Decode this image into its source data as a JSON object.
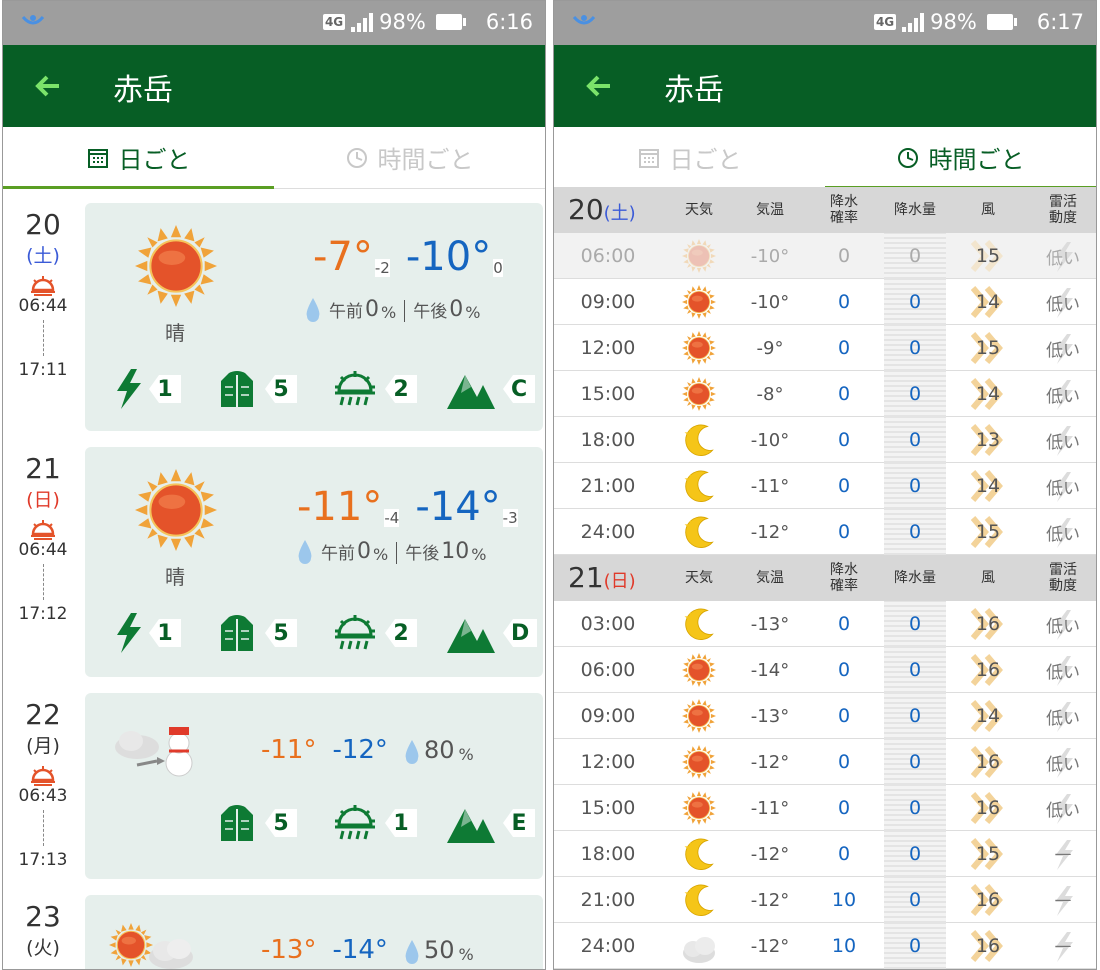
{
  "colors": {
    "appbar": "#075e25",
    "accent": "#5a9e23",
    "temp_high": "#e8701e",
    "temp_low": "#1565c0",
    "sat": "#3b5bd7",
    "sun": "#e03a2a"
  },
  "left": {
    "status": {
      "net": "4G",
      "battery": "98%",
      "time": "6:16"
    },
    "title": "赤岳",
    "tabs": [
      "日ごと",
      "時間ごと"
    ],
    "active_tab": 0,
    "days": [
      {
        "date": "20",
        "weekday": "(土)",
        "wk_color": "sat",
        "sunrise": "06:44",
        "sunset": "17:11",
        "icon": "sun-icon",
        "weather": "晴",
        "tmax": "-7°",
        "tmax_diff": "-2",
        "tmin": "-10°",
        "tmin_diff": "0",
        "am_label": "午前",
        "am": "0",
        "pm_label": "午後",
        "pm": "0",
        "pct": "%",
        "thunder": "1",
        "clothes": "5",
        "frost": "2",
        "climb": "C"
      },
      {
        "date": "21",
        "weekday": "(日)",
        "wk_color": "sun",
        "sunrise": "06:44",
        "sunset": "17:12",
        "icon": "sun-icon",
        "weather": "晴",
        "tmax": "-11°",
        "tmax_diff": "-4",
        "tmin": "-14°",
        "tmin_diff": "-3",
        "am_label": "午前",
        "am": "0",
        "pm_label": "午後",
        "pm": "10",
        "pct": "%",
        "thunder": "1",
        "clothes": "5",
        "frost": "2",
        "climb": "D"
      },
      {
        "date": "22",
        "weekday": "(月)",
        "wk_color": "",
        "sunrise": "06:43",
        "sunset": "17:13",
        "icon": "cloud-snow-icon",
        "tmax": "-11°",
        "tmin": "-12°",
        "rain": "80",
        "pct": "%",
        "clothes": "5",
        "frost": "1",
        "climb": "E"
      },
      {
        "date": "23",
        "weekday": "(火)",
        "wk_color": "",
        "icon": "sun-cloud-icon",
        "tmax": "-13°",
        "tmin": "-14°",
        "rain": "50",
        "pct": "%"
      }
    ]
  },
  "right": {
    "status": {
      "net": "4G",
      "battery": "98%",
      "time": "6:17"
    },
    "title": "赤岳",
    "tabs": [
      "日ごと",
      "時間ごと"
    ],
    "active_tab": 1,
    "headers": [
      "天気",
      "気温",
      "降水確率",
      "降水量",
      "風",
      "雷活動度"
    ],
    "groups": [
      {
        "date": "20",
        "weekday": "(土)",
        "wk_color": "sat",
        "rows": [
          {
            "time": "06:00",
            "icon": "sun",
            "temp": "-10°",
            "pop": "0",
            "amt": "0",
            "wind": "15",
            "thunder": "低い",
            "dim": true
          },
          {
            "time": "09:00",
            "icon": "sun",
            "temp": "-10°",
            "pop": "0",
            "amt": "0",
            "wind": "14",
            "thunder": "低い"
          },
          {
            "time": "12:00",
            "icon": "sun",
            "temp": "-9°",
            "pop": "0",
            "amt": "0",
            "wind": "15",
            "thunder": "低い"
          },
          {
            "time": "15:00",
            "icon": "sun",
            "temp": "-8°",
            "pop": "0",
            "amt": "0",
            "wind": "14",
            "thunder": "低い"
          },
          {
            "time": "18:00",
            "icon": "moon",
            "temp": "-10°",
            "pop": "0",
            "amt": "0",
            "wind": "13",
            "thunder": "低い"
          },
          {
            "time": "21:00",
            "icon": "moon",
            "temp": "-11°",
            "pop": "0",
            "amt": "0",
            "wind": "14",
            "thunder": "低い"
          },
          {
            "time": "24:00",
            "icon": "moon",
            "temp": "-12°",
            "pop": "0",
            "amt": "0",
            "wind": "15",
            "thunder": "低い"
          }
        ]
      },
      {
        "date": "21",
        "weekday": "(日)",
        "wk_color": "sun",
        "rows": [
          {
            "time": "03:00",
            "icon": "moon",
            "temp": "-13°",
            "pop": "0",
            "amt": "0",
            "wind": "16",
            "thunder": "低い"
          },
          {
            "time": "06:00",
            "icon": "sun",
            "temp": "-14°",
            "pop": "0",
            "amt": "0",
            "wind": "16",
            "thunder": "低い"
          },
          {
            "time": "09:00",
            "icon": "sun",
            "temp": "-13°",
            "pop": "0",
            "amt": "0",
            "wind": "14",
            "thunder": "低い"
          },
          {
            "time": "12:00",
            "icon": "sun",
            "temp": "-12°",
            "pop": "0",
            "amt": "0",
            "wind": "16",
            "thunder": "低い"
          },
          {
            "time": "15:00",
            "icon": "sun",
            "temp": "-11°",
            "pop": "0",
            "amt": "0",
            "wind": "16",
            "thunder": "低い"
          },
          {
            "time": "18:00",
            "icon": "moon",
            "temp": "-12°",
            "pop": "0",
            "amt": "0",
            "wind": "15",
            "thunder": "—"
          },
          {
            "time": "21:00",
            "icon": "moon",
            "temp": "-12°",
            "pop": "10",
            "amt": "0",
            "wind": "16",
            "thunder": "—"
          },
          {
            "time": "24:00",
            "icon": "cloud",
            "temp": "-12°",
            "pop": "10",
            "amt": "0",
            "wind": "16",
            "thunder": "—"
          }
        ]
      }
    ]
  }
}
